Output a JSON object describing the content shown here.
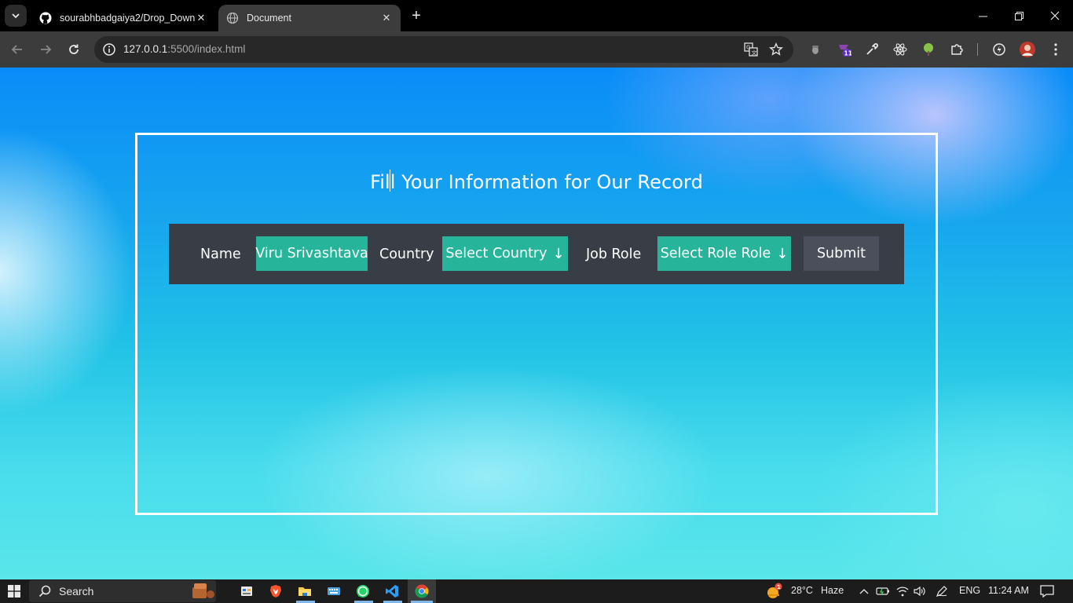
{
  "browser": {
    "tabs": [
      {
        "title": "sourabhbadgaiya2/Drop_Down",
        "icon": "github-icon"
      },
      {
        "title": "Document",
        "icon": "globe-icon"
      }
    ],
    "address": {
      "host": "127.0.0.1",
      "path": ":5500/index.html"
    }
  },
  "page": {
    "heading": "Fill Your Information for Our Record",
    "form": {
      "name_label": "Name",
      "name_value": "Viru Srivashtava",
      "country_label": "Country",
      "country_select": "Select Country",
      "role_label": "Job Role",
      "role_select": "Select Role Role",
      "arrow": "↓",
      "submit": "Submit"
    }
  },
  "taskbar": {
    "search": "Search",
    "weather_temp": "28°C",
    "weather_desc": "Haze",
    "weather_badge": "1",
    "lang": "ENG",
    "time": "11:24 AM",
    "ext_badge": "11"
  },
  "colors": {
    "form_bg": "#393e46",
    "chip": "#26b59b",
    "submit_bg": "#4a4f5b"
  }
}
